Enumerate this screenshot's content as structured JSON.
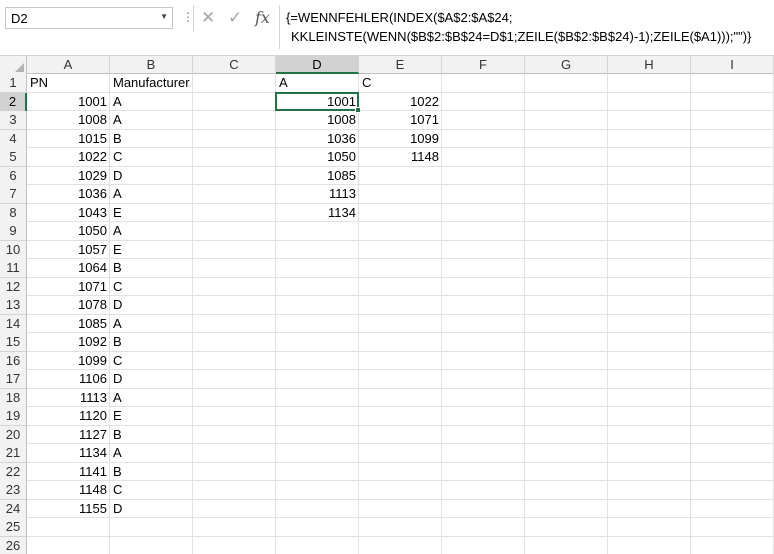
{
  "formula_bar": {
    "name_box": "D2",
    "formula_line1": "{=WENNFEHLER(INDEX($A$2:$A$24;",
    "formula_line2": "KKLEINSTE(WENN($B$2:$B$24=D$1;ZEILE($B$2:$B$24)-1);ZEILE($A1)));\"\")}",
    "cancel_icon": "close-icon",
    "enter_icon": "check-icon",
    "fx_label": "fx"
  },
  "columns": [
    "A",
    "B",
    "C",
    "D",
    "E",
    "F",
    "G",
    "H",
    "I"
  ],
  "selected_column": "D",
  "rows": [
    "1",
    "2",
    "3",
    "4",
    "5",
    "6",
    "7",
    "8",
    "9",
    "10",
    "11",
    "12",
    "13",
    "14",
    "15",
    "16",
    "17",
    "18",
    "19",
    "20",
    "21",
    "22",
    "23",
    "24",
    "25",
    "26"
  ],
  "selected_row": "2",
  "headers": {
    "A1": "PN",
    "B1": "Manufacturer",
    "D1": "A",
    "E1": "C"
  },
  "pn": [
    "1001",
    "1008",
    "1015",
    "1022",
    "1029",
    "1036",
    "1043",
    "1050",
    "1057",
    "1064",
    "1071",
    "1078",
    "1085",
    "1092",
    "1099",
    "1106",
    "1113",
    "1120",
    "1127",
    "1134",
    "1141",
    "1148",
    "1155"
  ],
  "manufacturer": [
    "A",
    "A",
    "B",
    "C",
    "D",
    "A",
    "E",
    "A",
    "E",
    "B",
    "C",
    "D",
    "A",
    "B",
    "C",
    "D",
    "A",
    "E",
    "B",
    "A",
    "B",
    "C",
    "D"
  ],
  "result_a": [
    "1001",
    "1008",
    "1036",
    "1050",
    "1085",
    "1113",
    "1134"
  ],
  "result_c": [
    "1022",
    "1071",
    "1099",
    "1148"
  ],
  "colors": {
    "accent": "#217346",
    "header_bg": "#f2f2f2",
    "selected_header_bg": "#d2d2d2",
    "gridline": "#e1e1e1"
  }
}
